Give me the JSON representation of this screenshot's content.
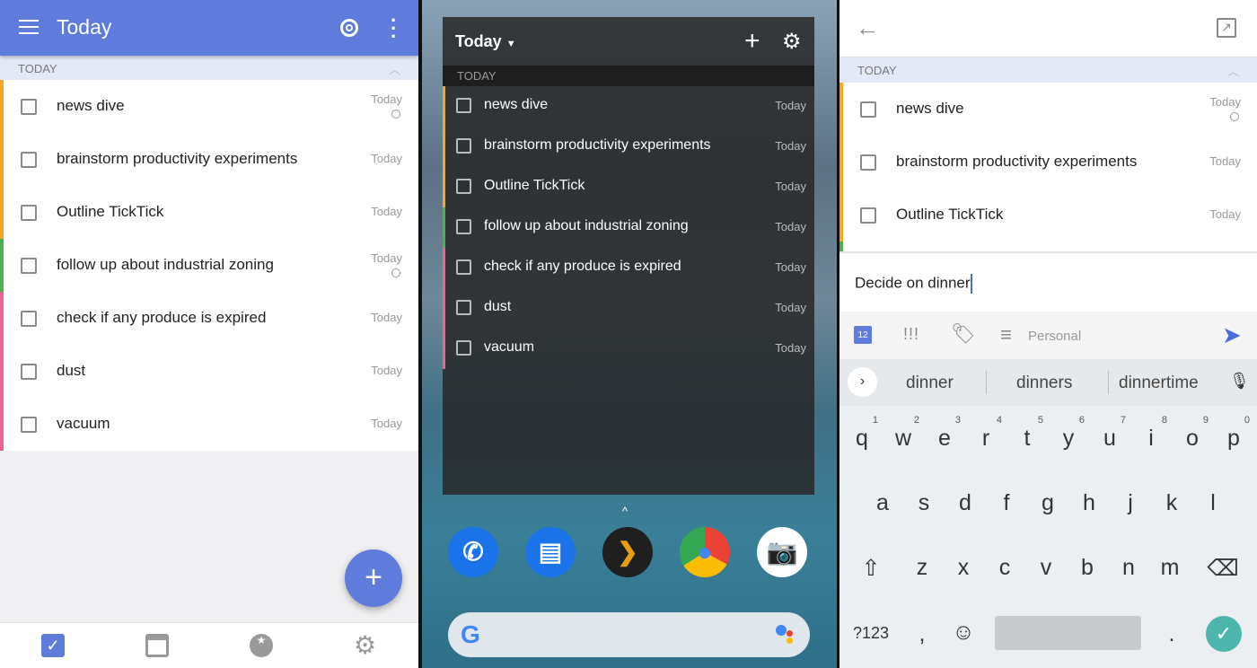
{
  "colors": {
    "accent": "#5f7bdc",
    "orange": "#f5a623",
    "green": "#4caf50",
    "pink": "#f06292"
  },
  "app": {
    "title": "Today",
    "section": "TODAY",
    "tasks": [
      {
        "text": "news dive",
        "date": "Today",
        "repeat": true,
        "color": "#f5a623"
      },
      {
        "text": "brainstorm productivity experiments",
        "date": "Today",
        "repeat": false,
        "color": "#f5a623"
      },
      {
        "text": "Outline TickTick",
        "date": "Today",
        "repeat": false,
        "color": "#f5a623"
      },
      {
        "text": "follow up about industrial zoning",
        "date": "Today",
        "repeat": true,
        "color": "#4caf50"
      },
      {
        "text": "check if any produce is expired",
        "date": "Today",
        "repeat": false,
        "color": "#f06292"
      },
      {
        "text": "dust",
        "date": "Today",
        "repeat": false,
        "color": "#f06292"
      },
      {
        "text": "vacuum",
        "date": "Today",
        "repeat": false,
        "color": "#f06292"
      }
    ],
    "fab": "+",
    "nav": [
      "tasks-icon",
      "calendar-icon",
      "habit-icon",
      "settings-icon"
    ]
  },
  "widget": {
    "title": "Today",
    "section": "TODAY",
    "add": "+",
    "dock": [
      "phone-icon",
      "messages-icon",
      "plex-icon",
      "chrome-icon",
      "camera-icon"
    ]
  },
  "editor": {
    "section": "TODAY",
    "input": "Decide on dinner",
    "calendar_day": "12",
    "priority": "!!!",
    "list": "Personal",
    "suggestions": [
      "dinner",
      "dinners",
      "dinnertime"
    ],
    "keys": {
      "row1": [
        "q",
        "w",
        "e",
        "r",
        "t",
        "y",
        "u",
        "i",
        "o",
        "p"
      ],
      "nums": [
        "1",
        "2",
        "3",
        "4",
        "5",
        "6",
        "7",
        "8",
        "9",
        "0"
      ],
      "row2": [
        "a",
        "s",
        "d",
        "f",
        "g",
        "h",
        "j",
        "k",
        "l"
      ],
      "row3": [
        "z",
        "x",
        "c",
        "v",
        "b",
        "n",
        "m"
      ],
      "symbols": "?123",
      "comma": ",",
      "period": "."
    }
  }
}
